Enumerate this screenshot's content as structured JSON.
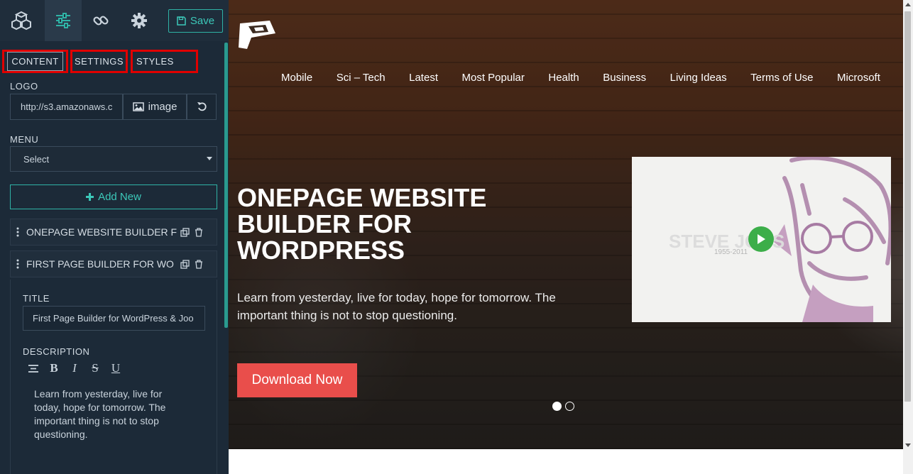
{
  "toolbar": {
    "icons": [
      "cubes-icon",
      "sliders-icon",
      "link-icon",
      "gear-icon"
    ],
    "save_label": "Save",
    "accent": "#2fb3a6"
  },
  "tabs": [
    {
      "label": "CONTENT"
    },
    {
      "label": "SETTINGS"
    },
    {
      "label": "STYLES"
    }
  ],
  "logo": {
    "label": "LOGO",
    "value": "http://s3.amazonaws.c",
    "image_button": "image"
  },
  "menu": {
    "label": "MENU",
    "selected": "Select"
  },
  "add_new_label": "Add New",
  "items": [
    {
      "label": "ONEPAGE WEBSITE BUILDER F"
    },
    {
      "label": "FIRST PAGE BUILDER FOR WO"
    }
  ],
  "editor": {
    "title_label": "TITLE",
    "title_value": "First Page Builder for WordPress & Joo",
    "description_label": "DESCRIPTION",
    "description_text": "Learn from yesterday, live for today, hope for tomorrow. The important thing is not to stop questioning."
  },
  "preview": {
    "nav": [
      "Mobile",
      "Sci – Tech",
      "Latest",
      "Most Popular",
      "Health",
      "Business",
      "Living Ideas",
      "Terms of Use",
      "Microsoft"
    ],
    "hero_title": "ONEPAGE WEBSITE BUILDER FOR WORDPRESS",
    "hero_description": "Learn from yesterday, live for today, hope for tomorrow. The important thing is not to stop questioning.",
    "cta_label": "Download Now",
    "cta_color": "#e94e4b",
    "video_caption": "STEVE JOBS",
    "video_years": "1955-2011",
    "slides_total": 2,
    "slide_active": 1
  }
}
